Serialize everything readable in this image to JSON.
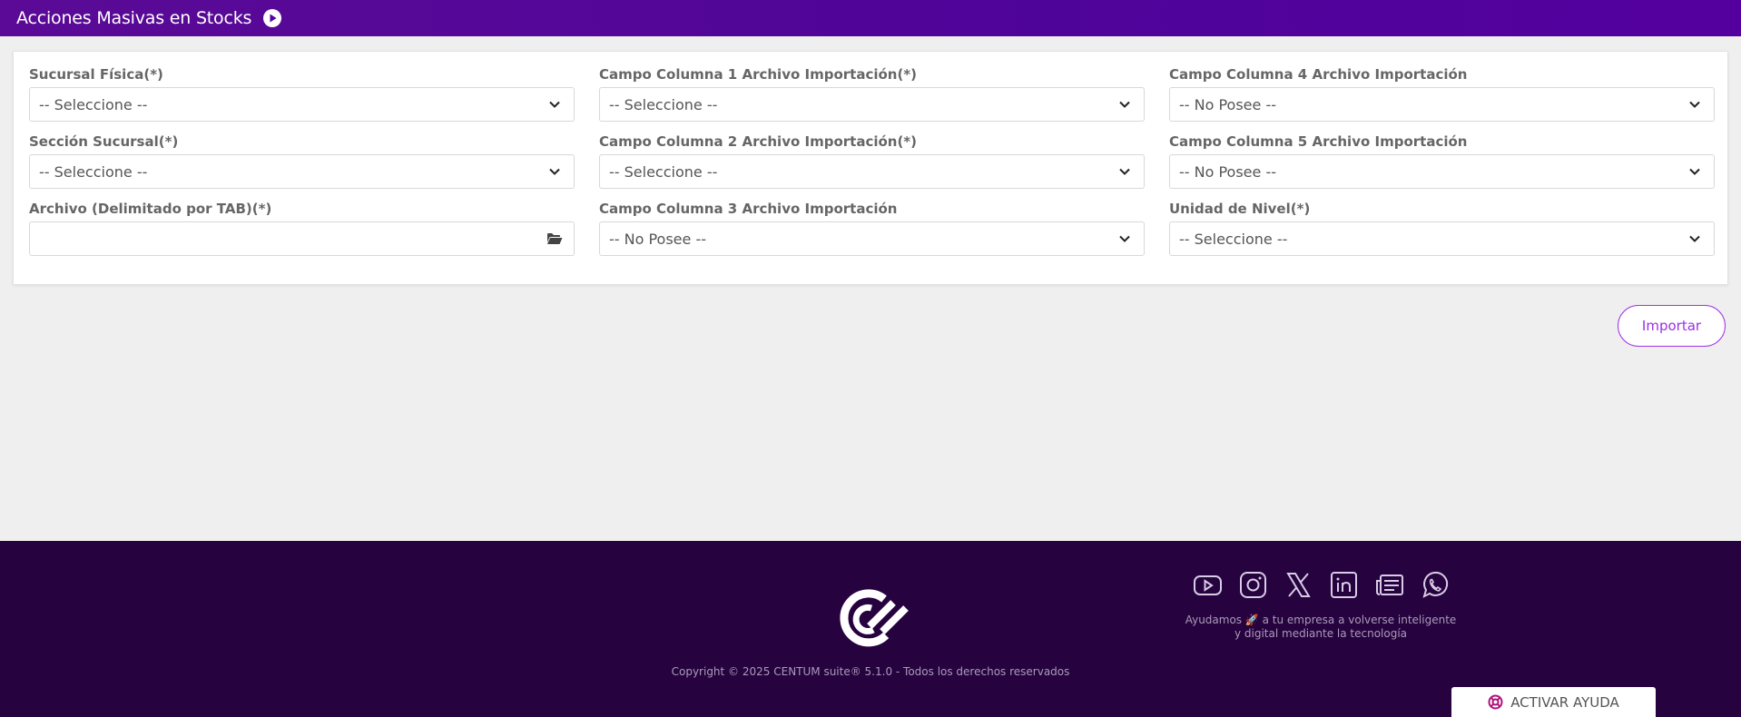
{
  "header": {
    "title": "Acciones Masivas en Stocks"
  },
  "form": {
    "sucursal_fisica": {
      "label": "Sucursal Física(*)",
      "value": "-- Seleccione --"
    },
    "seccion_sucursal": {
      "label": "Sección Sucursal(*)",
      "value": "-- Seleccione --"
    },
    "archivo": {
      "label": "Archivo (Delimitado por TAB)(*)",
      "value": ""
    },
    "columna1": {
      "label": "Campo Columna 1 Archivo Importación(*)",
      "value": "-- Seleccione --"
    },
    "columna2": {
      "label": "Campo Columna 2 Archivo Importación(*)",
      "value": "-- Seleccione --"
    },
    "columna3": {
      "label": "Campo Columna 3 Archivo Importación",
      "value": "-- No Posee --"
    },
    "columna4": {
      "label": "Campo Columna 4 Archivo Importación",
      "value": "-- No Posee --"
    },
    "columna5": {
      "label": "Campo Columna 5 Archivo Importación",
      "value": "-- No Posee --"
    },
    "unidad_nivel": {
      "label": "Unidad de Nivel(*)",
      "value": "-- Seleccione --"
    }
  },
  "actions": {
    "import_label": "Importar"
  },
  "footer": {
    "copyright": "Copyright © 2025 CENTUM suite® 5.1.0 - Todos los derechos reservados",
    "tagline_line1": "Ayudamos 🚀 a tu empresa a volverse inteligente",
    "tagline_line2": "y digital mediante la tecnología",
    "social_icons": [
      "youtube-icon",
      "instagram-icon",
      "x-icon",
      "linkedin-icon",
      "news-icon",
      "whatsapp-icon"
    ]
  },
  "help": {
    "label": "ACTIVAR AYUDA"
  },
  "colors": {
    "header": "#54009f",
    "footer": "#26023f",
    "accent": "#9b30e4"
  }
}
